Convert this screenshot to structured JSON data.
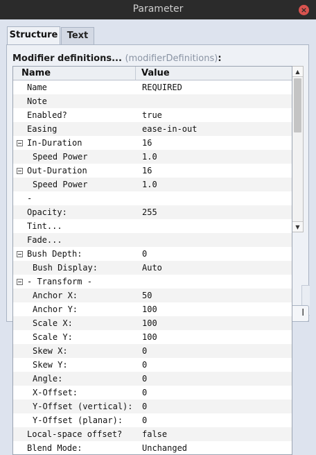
{
  "window": {
    "title": "Parameter",
    "close_glyph": "×"
  },
  "tabs": [
    {
      "label": "Structure",
      "active": true
    },
    {
      "label": "Text",
      "active": false
    }
  ],
  "panel": {
    "label_main": "Modifier definitions...",
    "label_param": "(modifierDefinitions)",
    "label_colon": ":",
    "ghost_button_text": "l"
  },
  "list": {
    "columns": {
      "name": "Name",
      "value": "Value"
    },
    "rows": [
      {
        "name": "Name",
        "value": "REQUIRED"
      },
      {
        "name": "Note",
        "value": ""
      },
      {
        "name": "Enabled?",
        "value": "true"
      },
      {
        "name": "Easing",
        "value": "ease-in-out"
      },
      {
        "name": "In-Duration",
        "value": "16",
        "expandable": true
      },
      {
        "name": "Speed Power",
        "value": "1.0",
        "indent": true
      },
      {
        "name": "Out-Duration",
        "value": "16",
        "expandable": true
      },
      {
        "name": "Speed Power",
        "value": "1.0",
        "indent": true
      },
      {
        "name": "-",
        "value": ""
      },
      {
        "name": "Opacity:",
        "value": "255"
      },
      {
        "name": "Tint...",
        "value": ""
      },
      {
        "name": "Fade...",
        "value": ""
      },
      {
        "name": "Bush Depth:",
        "value": "0",
        "expandable": true
      },
      {
        "name": "Bush Display:",
        "value": "Auto",
        "indent": true
      },
      {
        "name": "- Transform -",
        "value": "",
        "expandable": true
      },
      {
        "name": "Anchor X:",
        "value": "50",
        "indent": true
      },
      {
        "name": "Anchor Y:",
        "value": "100",
        "indent": true
      },
      {
        "name": "Scale X:",
        "value": "100",
        "indent": true
      },
      {
        "name": "Scale Y:",
        "value": "100",
        "indent": true
      },
      {
        "name": "Skew X:",
        "value": "0",
        "indent": true
      },
      {
        "name": "Skew Y:",
        "value": "0",
        "indent": true
      },
      {
        "name": "Angle:",
        "value": "0",
        "indent": true
      },
      {
        "name": "X-Offset:",
        "value": "0",
        "indent": true
      },
      {
        "name": "Y-Offset (vertical):",
        "value": "0",
        "indent": true
      },
      {
        "name": "Y-Offset (planar):",
        "value": "0",
        "indent": true
      },
      {
        "name": "Local-space offset?",
        "value": "false"
      },
      {
        "name": "Blend Mode:",
        "value": "Unchanged"
      }
    ]
  },
  "scrollbar": {
    "up_glyph": "▲",
    "down_glyph": "▼"
  },
  "colors": {
    "titlebar": "#2b2b2b",
    "window_bg": "#dde3ee",
    "close_button": "#d9534f"
  }
}
